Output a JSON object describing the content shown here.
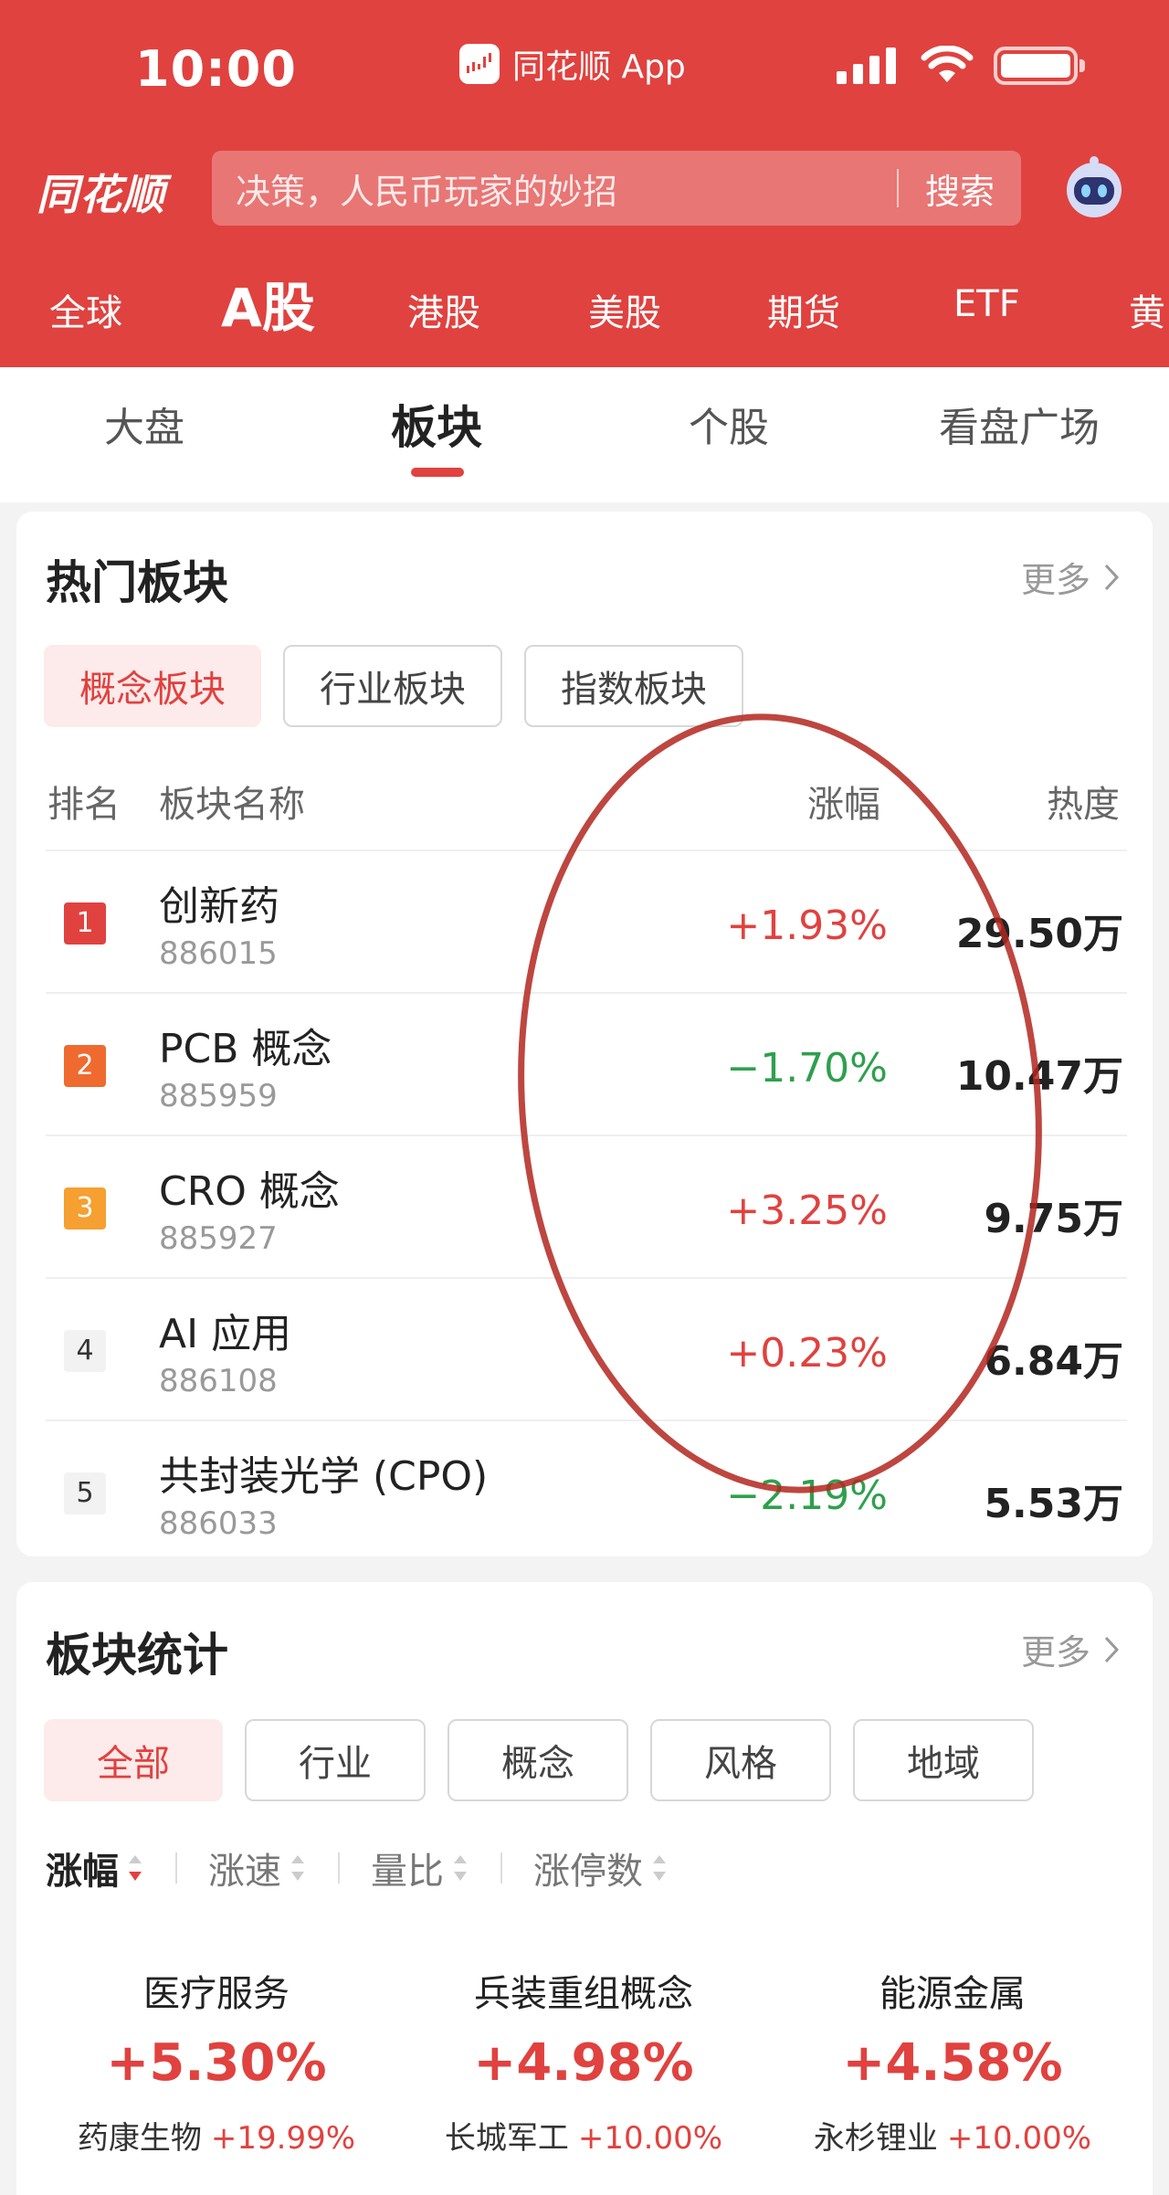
{
  "status_bar": {
    "time": "10:00",
    "app_label": "同花顺 App"
  },
  "header": {
    "logo": "同花顺",
    "search_placeholder": "决策，人民币玩家的妙招",
    "search_button": "搜索",
    "assistant_icon": "robot-icon"
  },
  "market_tabs": [
    "全球",
    "A股",
    "港股",
    "美股",
    "期货",
    "ETF",
    "黄"
  ],
  "market_tab_active": "A股",
  "sub_tabs": [
    "大盘",
    "板块",
    "个股",
    "看盘广场"
  ],
  "sub_tab_active": "板块",
  "hot_sectors": {
    "title": "热门板块",
    "more": "更多",
    "chips": [
      "概念板块",
      "行业板块",
      "指数板块"
    ],
    "active_chip": "概念板块",
    "columns": {
      "rank": "排名",
      "name": "板块名称",
      "change": "涨幅",
      "heat": "热度"
    },
    "rows": [
      {
        "rank": "1",
        "name": "创新药",
        "code": "886015",
        "change": "+1.93%",
        "direction": "up",
        "heat": "29.50万"
      },
      {
        "rank": "2",
        "name": "PCB 概念",
        "code": "885959",
        "change": "−1.70%",
        "direction": "down",
        "heat": "10.47万"
      },
      {
        "rank": "3",
        "name": "CRO 概念",
        "code": "885927",
        "change": "+3.25%",
        "direction": "up",
        "heat": "9.75万"
      },
      {
        "rank": "4",
        "name": "AI 应用",
        "code": "886108",
        "change": "+0.23%",
        "direction": "up",
        "heat": "6.84万"
      },
      {
        "rank": "5",
        "name": "共封装光学 (CPO)",
        "code": "886033",
        "change": "−2.19%",
        "direction": "down",
        "heat": "5.53万"
      }
    ]
  },
  "sector_stats": {
    "title": "板块统计",
    "more": "更多",
    "chips": [
      "全部",
      "行业",
      "概念",
      "风格",
      "地域"
    ],
    "active_chip": "全部",
    "sort_tabs": [
      "涨幅",
      "涨速",
      "量比",
      "涨停数"
    ],
    "active_sort": "涨幅",
    "items": [
      {
        "name": "医疗服务",
        "change": "+5.30%",
        "leader": "药康生物",
        "leader_change": "+19.99%"
      },
      {
        "name": "兵装重组概念",
        "change": "+4.98%",
        "leader": "长城军工",
        "leader_change": "+10.00%"
      },
      {
        "name": "能源金属",
        "change": "+4.58%",
        "leader": "永杉锂业",
        "leader_change": "+10.00%"
      }
    ]
  },
  "colors": {
    "brand_red": "#e0423f",
    "down_green": "#2ea04d",
    "annotation": "#b3261e"
  }
}
